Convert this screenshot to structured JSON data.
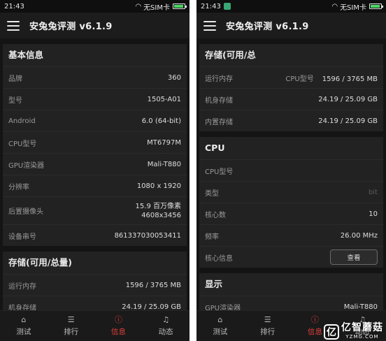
{
  "colors": {
    "accent": "#e0403a",
    "background": "#141414",
    "card": "#222222"
  },
  "left": {
    "status": {
      "time": "21:43",
      "sim": "无SIM卡",
      "battery_level": 0.85
    },
    "app_title": "安兔兔评测 v6.1.9",
    "basic": {
      "title": "基本信息",
      "rows": [
        {
          "label": "品牌",
          "value": "360"
        },
        {
          "label": "型号",
          "value": "1505-A01"
        },
        {
          "label": "Android",
          "value": "6.0 (64-bit)"
        },
        {
          "label": "CPU型号",
          "value": "MT6797M"
        },
        {
          "label": "GPU渲染器",
          "value": "Mali-T880"
        },
        {
          "label": "分辨率",
          "value": "1080 x 1920"
        }
      ],
      "camera_label": "后置摄像头",
      "camera_line1": "15.9 百万像素",
      "camera_line2": "4608x3456",
      "serial_label": "设备串号",
      "serial_value": "861337030053411"
    },
    "storage": {
      "title": "存储(可用/总量)",
      "rows": [
        {
          "label": "运行内存",
          "value": "1596 / 3765 MB"
        },
        {
          "label": "机身存储",
          "value": "24.19 / 25.09 GB"
        }
      ]
    }
  },
  "right": {
    "status": {
      "time": "21:43",
      "sim": "无SIM卡",
      "battery_level": 0.85
    },
    "app_title": "安兔兔评测 v6.1.9",
    "storage": {
      "title": "存储(可用/总",
      "rows": [
        {
          "label": "运行内存",
          "overlay": "CPU型号",
          "value": "1596 / 3765 MB"
        },
        {
          "label": "机身存储",
          "value": "24.19 / 25.09 GB"
        },
        {
          "label": "内置存储",
          "value": "24.19 / 25.09 GB"
        }
      ]
    },
    "cpu": {
      "title": "CPU",
      "model_label": "CPU型号",
      "type_label": "类型",
      "type_value": "bit",
      "cores_label": "核心数",
      "cores_value": "10",
      "freq_label": "频率",
      "freq_value": "26.00 MHz",
      "coreinfo_label": "核心信息",
      "view_button": "查看"
    },
    "display": {
      "title": "显示",
      "gpu_label": "GPU渲染器",
      "gpu_value": "Mali-T880"
    }
  },
  "nav": [
    {
      "label": "测试",
      "icon": "home-icon",
      "glyph": "⌂"
    },
    {
      "label": "排行",
      "icon": "list-icon",
      "glyph": "☰"
    },
    {
      "label": "信息",
      "icon": "info-icon",
      "glyph": "ⓘ"
    },
    {
      "label": "动态",
      "icon": "bell-icon",
      "glyph": "♫"
    }
  ],
  "watermark": {
    "logo": "亿",
    "name": "亿智蘑菇",
    "url": "YZMG.COM"
  }
}
